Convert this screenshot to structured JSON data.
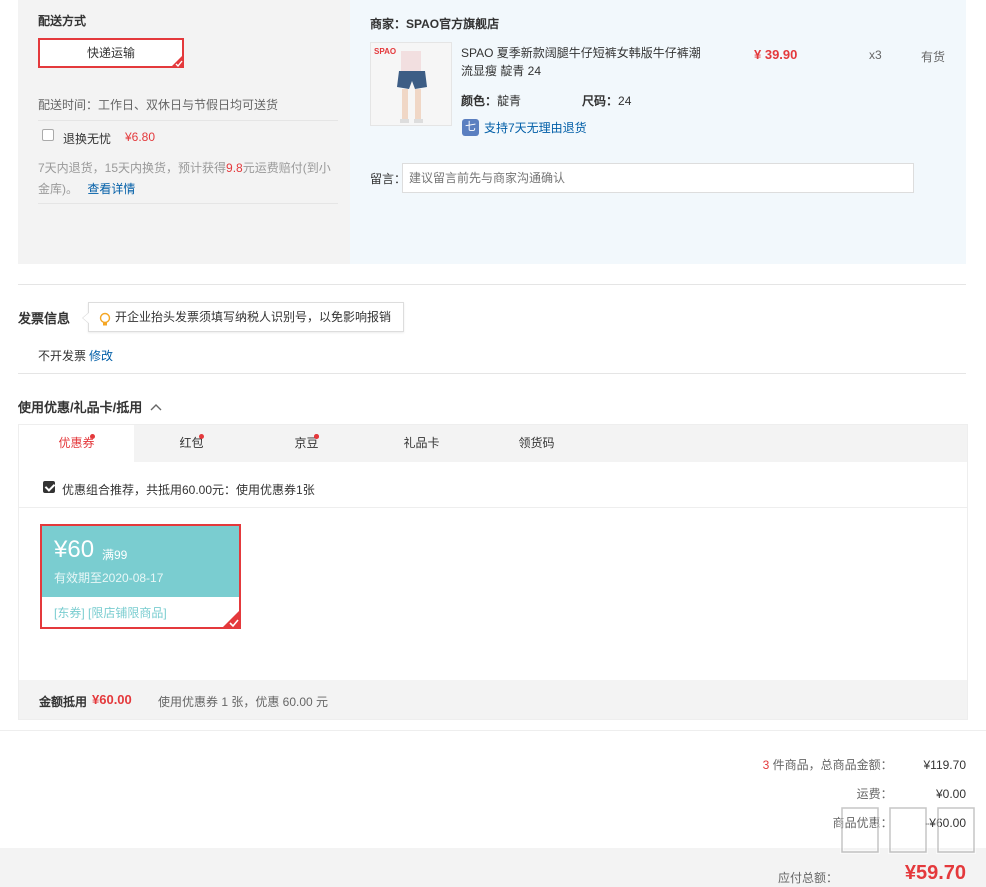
{
  "shipping": {
    "title": "配送方式",
    "method": "快递运输",
    "time_label": "配送时间：工作日、双休日与节假日均可送货",
    "return_option_label": "退换无忧",
    "return_option_price": "¥6.80",
    "return_desc_prefix": "7天内退货，15天内换货，预计获得",
    "return_desc_amount": "9.8",
    "return_desc_suffix": "元运费赔付(到小金库)。",
    "details_link": "查看详情"
  },
  "shop": {
    "seller_label": "商家：SPAO官方旗舰店",
    "product_title": "SPAO 夏季新款阔腿牛仔短裤女韩版牛仔裤潮流显瘦 靛青 24",
    "thumb_logo": "SPAO",
    "price": "¥ 39.90",
    "quantity": "x3",
    "stock": "有货",
    "color_label": "颜色：",
    "color_value": "靛青",
    "size_label": "尺码：",
    "size_value": "24",
    "return_badge": "七",
    "return_policy": "支持7天无理由退货",
    "remark_label": "留言：",
    "remark_placeholder": "建议留言前先与商家沟通确认"
  },
  "invoice": {
    "title": "发票信息",
    "tip": "开企业抬头发票须填写纳税人识别号，以免影响报销",
    "status": "不开发票",
    "edit_link": "修改"
  },
  "discounts": {
    "title": "使用优惠/礼品卡/抵用",
    "tabs": [
      {
        "label": "优惠券",
        "dot": true
      },
      {
        "label": "红包",
        "dot": true
      },
      {
        "label": "京豆",
        "dot": true
      },
      {
        "label": "礼品卡",
        "dot": false
      },
      {
        "label": "领货码",
        "dot": false
      }
    ],
    "recommend_text": "优惠组合推荐，共抵用60.00元：使用优惠券1张",
    "coupon": {
      "amount": "¥60",
      "condition": "满99",
      "expiry": "有效期至2020-08-17",
      "tags": "[东券]  [限店铺限商品]"
    },
    "footer_label": "金额抵用",
    "footer_amount": "¥60.00",
    "footer_desc": "使用优惠券 1 张，优惠 60.00 元"
  },
  "summary": {
    "item_count": "3",
    "goods_label": "件商品，总商品金额：",
    "goods_total": "¥119.70",
    "freight_label": "运费：",
    "freight_value": "¥0.00",
    "discount_label": "商品优惠：",
    "discount_value": "-¥60.00",
    "payable_label": "应付总额：",
    "payable_value": "¥59.70"
  },
  "watermark": "值 什么值得买",
  "colors": {
    "accent_red": "#e4393c",
    "coupon_teal": "#7acdd0",
    "link_blue": "#005ea7"
  }
}
